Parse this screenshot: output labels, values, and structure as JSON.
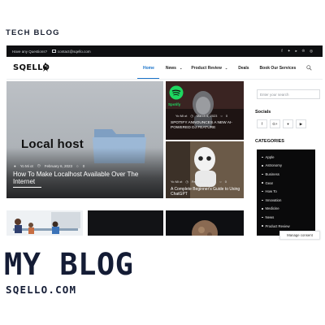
{
  "page": {
    "heading": "TECH BLOG",
    "big_title": "MY BLOG",
    "domain": "SQELLO.COM"
  },
  "topbar": {
    "question": "Have any Questions?",
    "email": "contact@sqello.com",
    "social_icons": [
      "facebook-icon",
      "twitter-icon",
      "youtube-icon",
      "pinterest-icon",
      "instagram-icon"
    ]
  },
  "header": {
    "logo": "SQELLO",
    "nav": [
      "Home",
      "News",
      "Product Review",
      "Deals",
      "Book Our Services"
    ],
    "active_nav": "Home",
    "accent": "#1a73c9"
  },
  "hero": {
    "image_text": "Local host",
    "author": "Yo Mi ot",
    "date": "February 6, 2023",
    "comments": "0",
    "title": "How To Make Localhost Available Over The Internet"
  },
  "cards": [
    {
      "brand": "Spotify",
      "author": "Yo Mi ot",
      "date": "March 6, 2023",
      "comments": "0",
      "title": "SPOTIFY ANNOUNCES A NEW AI-POWERED DJ FEATURE"
    },
    {
      "author": "Yo Mi ot",
      "date": "February 2, 2023",
      "comments": "0",
      "title": "A Complete Beginner's Guide to Using ChatGPT"
    }
  ],
  "sidebar": {
    "search_placeholder": "Enter your search",
    "socials_title": "Socials",
    "social_buttons": [
      "f",
      "G+",
      "▾",
      "▶"
    ],
    "categories_title": "CATEGORIES",
    "categories": [
      "Apple",
      "Astronomy",
      "Business",
      "Gear",
      "How To",
      "Innovation",
      "Medicine",
      "News",
      "Product Review"
    ]
  },
  "consent": {
    "label": "Manage consent"
  }
}
